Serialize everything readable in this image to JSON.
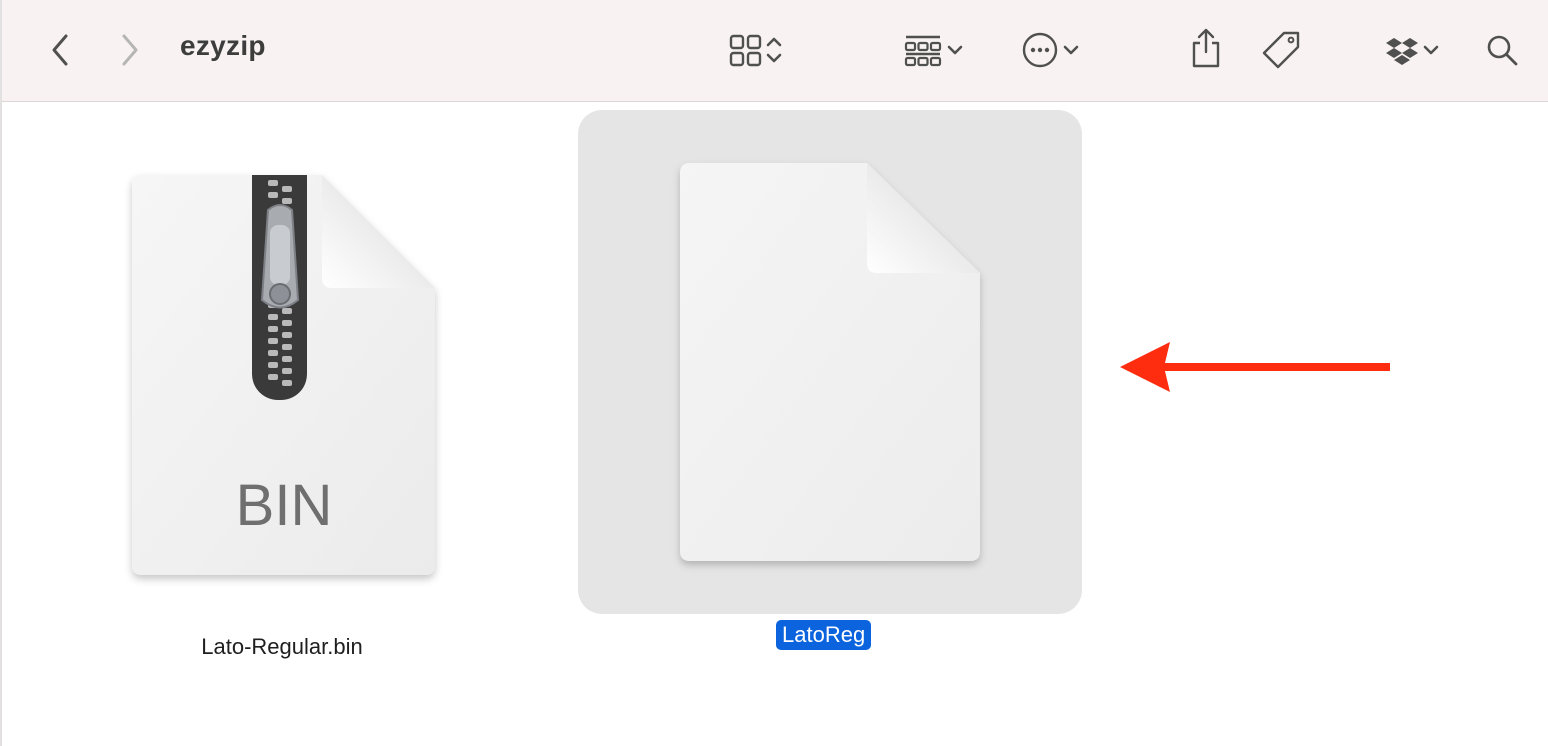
{
  "window": {
    "title": "ezyzip"
  },
  "toolbar": {
    "back_icon": "chevron-left-icon",
    "forward_icon": "chevron-right-icon",
    "view_icon": "icon-grid-view-icon",
    "group_icon": "group-by-icon",
    "more_icon": "ellipsis-circle-icon",
    "share_icon": "share-icon",
    "tag_icon": "tag-icon",
    "dropbox_icon": "dropbox-icon",
    "search_icon": "search-icon"
  },
  "files": [
    {
      "name": "Lato-Regular.bin",
      "type_label": "BIN",
      "icon": "zip-archive-document-icon",
      "selected": false
    },
    {
      "name": "LatoReg",
      "icon": "blank-document-icon",
      "selected": true
    }
  ],
  "annotation": {
    "icon": "red-arrow-left-icon",
    "color": "#ff2d10"
  },
  "colors": {
    "selection_bg": "#e5e5e5",
    "label_highlight": "#0b63dd",
    "toolbar_bg": "#f8f2f2"
  }
}
